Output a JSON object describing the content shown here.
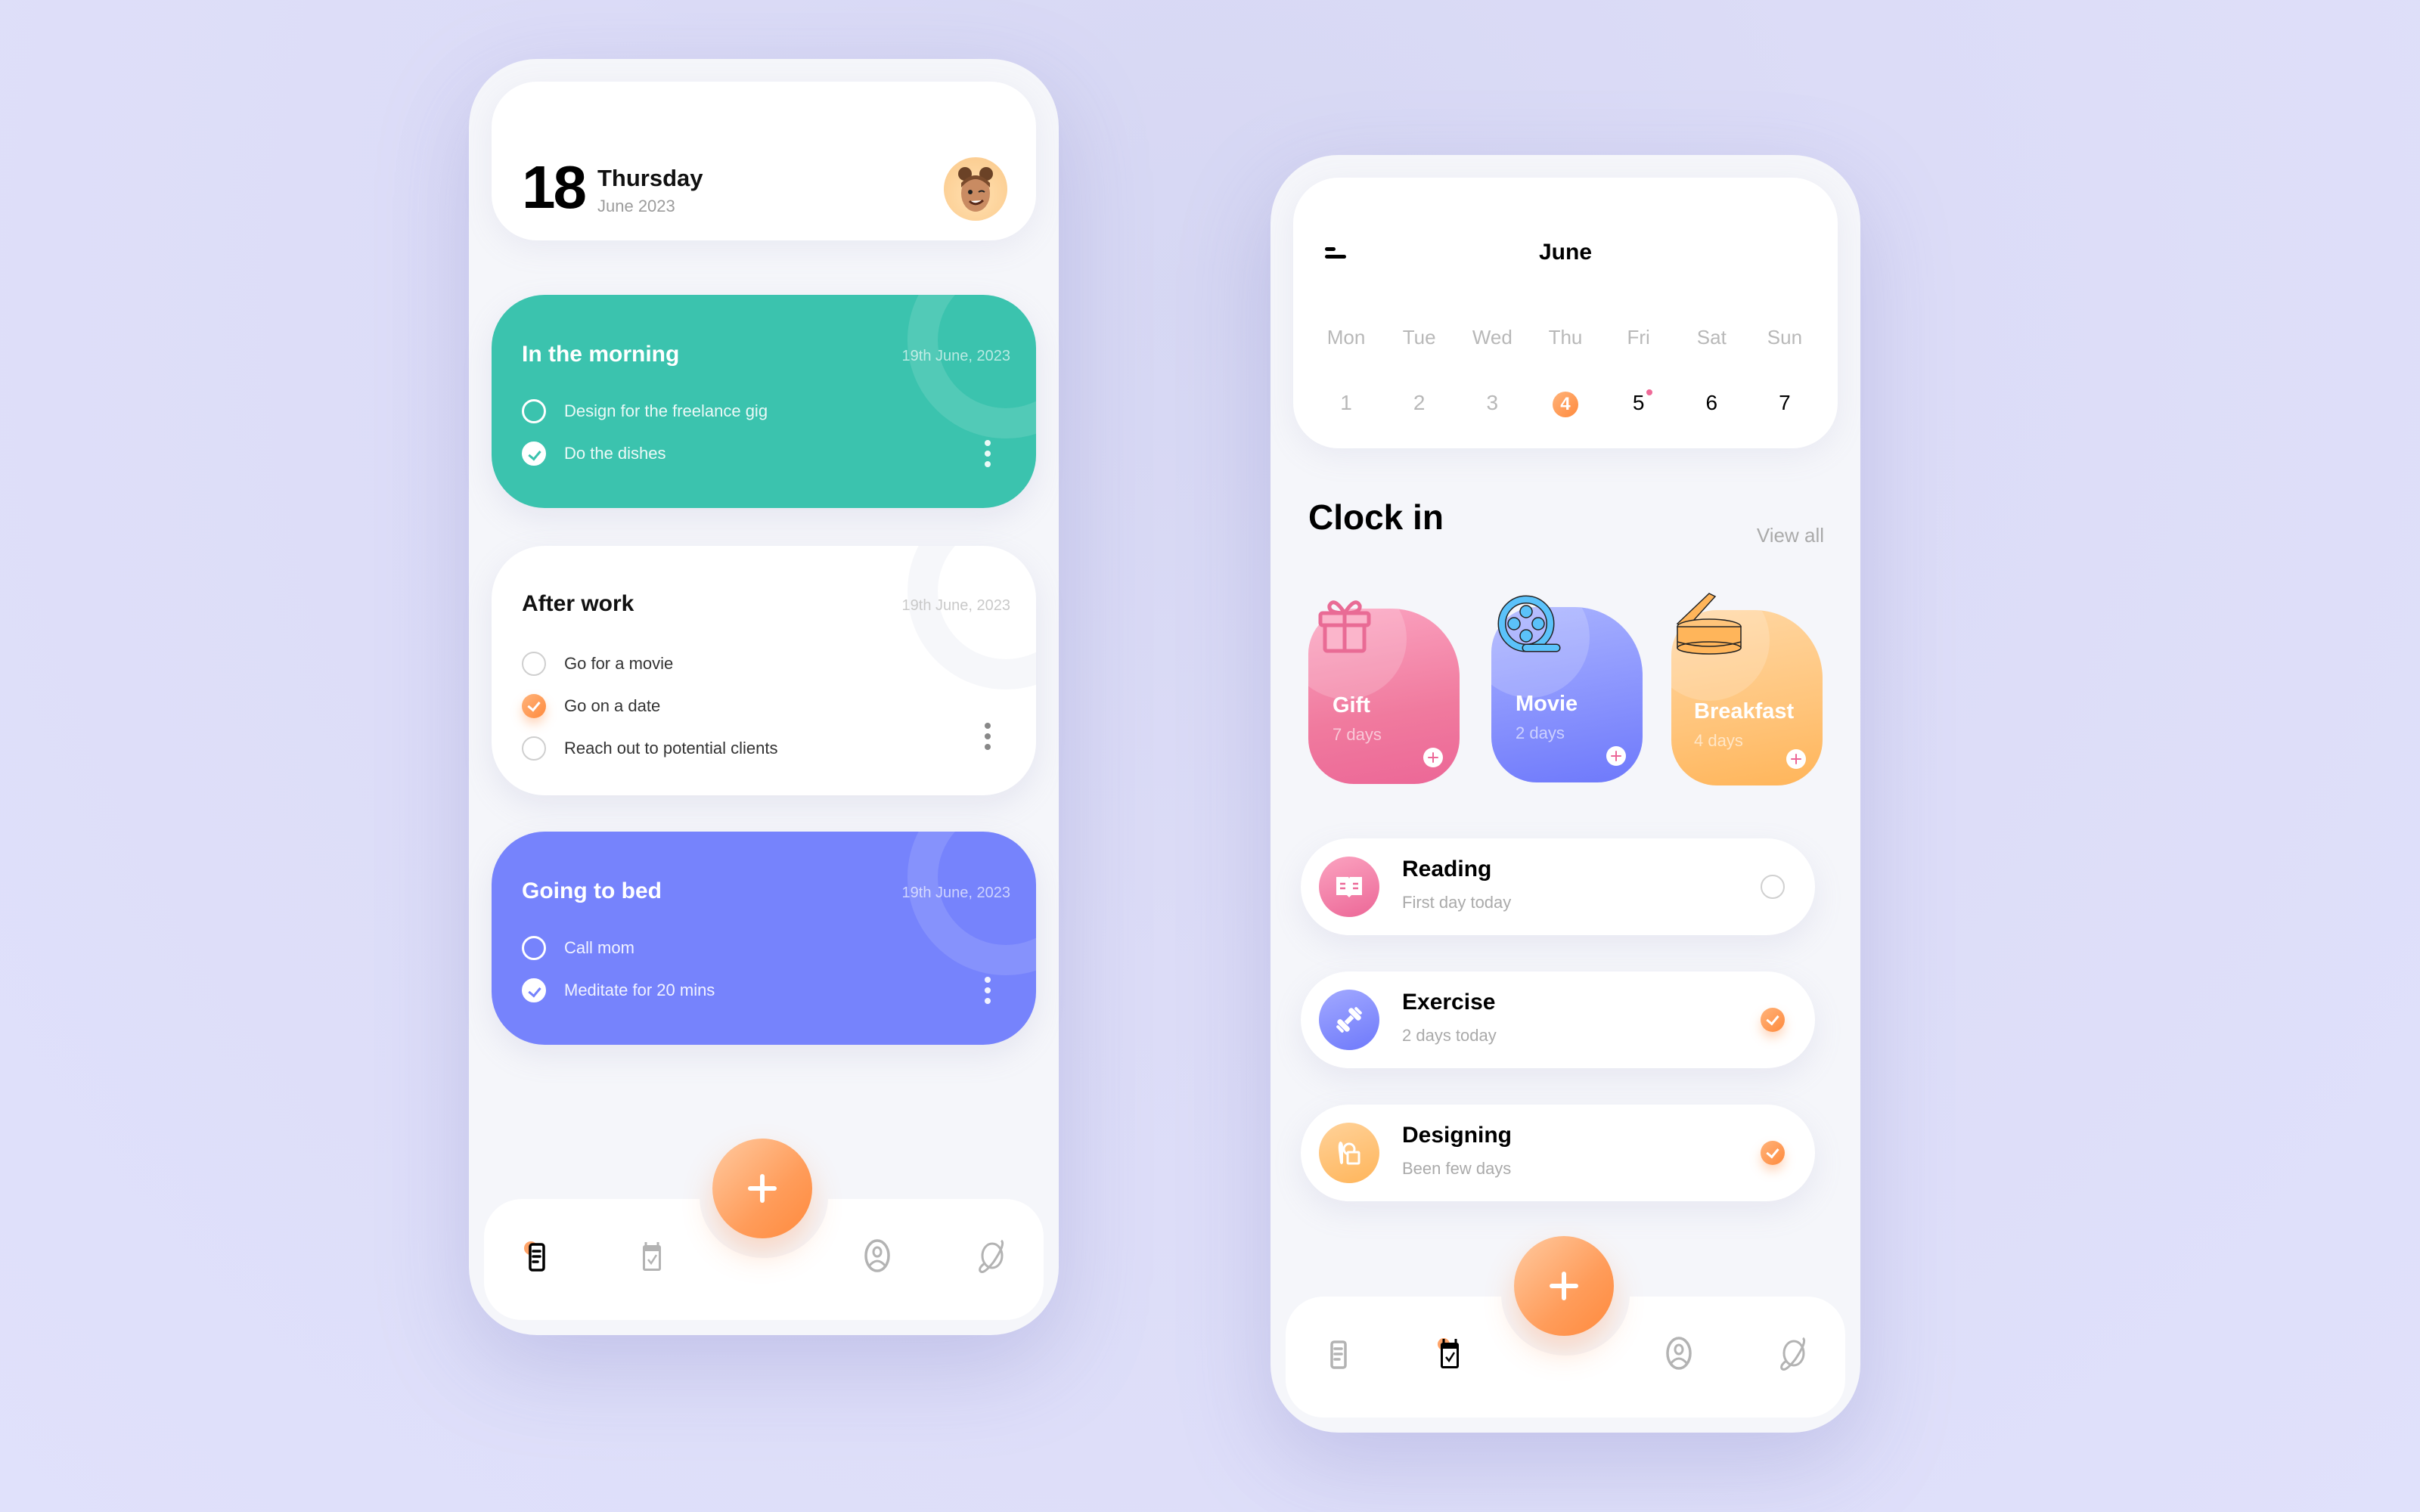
{
  "colors": {
    "background": "#dfe0fa",
    "phone_bg": "#f5f6fa",
    "accent_orange": "#ff8a3d",
    "green_card": "#3bc3ae",
    "purple_card": "#7683fc",
    "pink": "#ec6797",
    "yellow": "#ffb55a"
  },
  "left_screen": {
    "header": {
      "day_number": "18",
      "weekday": "Thursday",
      "month_year": "June 2023",
      "avatar_icon": "memoji-avatar"
    },
    "task_groups": [
      {
        "title": "In the morning",
        "date": "19th June, 2023",
        "theme": "green",
        "tasks": [
          {
            "label": "Design for the freelance gig",
            "done": false
          },
          {
            "label": "Do the dishes",
            "done": true
          }
        ]
      },
      {
        "title": "After work",
        "date": "19th June, 2023",
        "theme": "white",
        "tasks": [
          {
            "label": "Go for a movie",
            "done": false
          },
          {
            "label": "Go on a date",
            "done": true
          },
          {
            "label": "Reach out to potential clients",
            "done": false
          }
        ]
      },
      {
        "title": "Going to bed",
        "date": "19th June, 2023",
        "theme": "purple",
        "tasks": [
          {
            "label": "Call mom",
            "done": false
          },
          {
            "label": "Meditate for 20 mins",
            "done": true
          }
        ]
      }
    ],
    "nav": {
      "items": [
        {
          "icon": "notes-icon",
          "active": true
        },
        {
          "icon": "calendar-check-icon",
          "active": false
        },
        {
          "icon": "add-icon",
          "fab": true
        },
        {
          "icon": "profile-icon",
          "active": false
        },
        {
          "icon": "planet-icon",
          "active": false
        }
      ]
    }
  },
  "right_screen": {
    "calendar": {
      "month": "June",
      "weekdays": [
        "Mon",
        "Tue",
        "Wed",
        "Thu",
        "Fri",
        "Sat",
        "Sun"
      ],
      "dates": [
        "1",
        "2",
        "3",
        "4",
        "5",
        "6",
        "7"
      ],
      "selected_date": "4",
      "event_date": "5"
    },
    "clock_in": {
      "title": "Clock in",
      "view_all": "View all",
      "cards": [
        {
          "name": "Gift",
          "days": "7 days",
          "icon": "gift-icon"
        },
        {
          "name": "Movie",
          "days": "2 days",
          "icon": "film-reel-icon"
        },
        {
          "name": "Breakfast",
          "days": "4 days",
          "icon": "can-icon"
        }
      ]
    },
    "habits": [
      {
        "name": "Reading",
        "subtitle": "First day today",
        "icon": "book-icon",
        "done": false
      },
      {
        "name": "Exercise",
        "subtitle": "2 days today",
        "icon": "dumbbell-icon",
        "done": true
      },
      {
        "name": "Designing",
        "subtitle": "Been few days",
        "icon": "design-tools-icon",
        "done": true
      }
    ],
    "nav": {
      "items": [
        {
          "icon": "notes-icon",
          "active": false
        },
        {
          "icon": "calendar-check-icon",
          "active": true
        },
        {
          "icon": "add-icon",
          "fab": true
        },
        {
          "icon": "profile-icon",
          "active": false
        },
        {
          "icon": "planet-icon",
          "active": false
        }
      ]
    }
  }
}
